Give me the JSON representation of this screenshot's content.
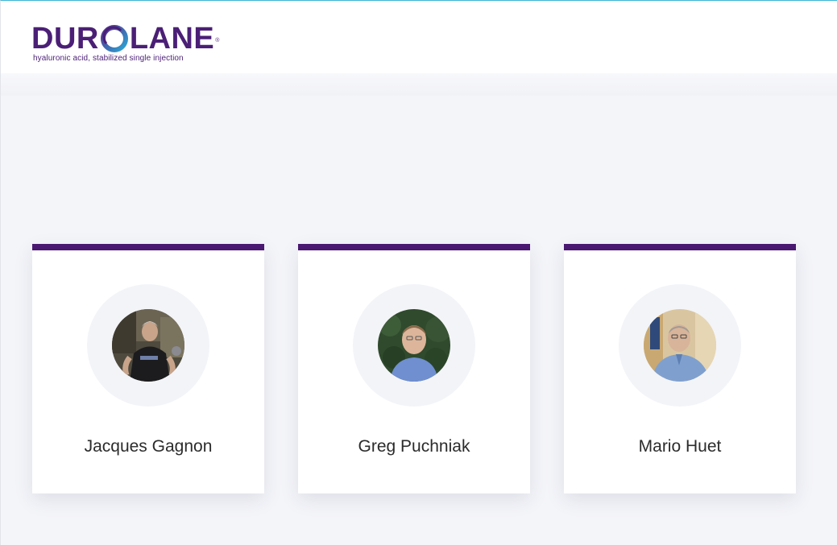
{
  "brand": {
    "name_left": "DUR",
    "name_right": "LANE",
    "registered": "®",
    "tagline": "hyaluronic acid, stabilized single injection",
    "colors": {
      "primary": "#4b1f76",
      "accent": "#3bb6d6"
    }
  },
  "testimonials": [
    {
      "name": "Jacques Gagnon",
      "avatar_icon": "runner-photo"
    },
    {
      "name": "Greg Puchniak",
      "avatar_icon": "man-outdoors-photo"
    },
    {
      "name": "Mario Huet",
      "avatar_icon": "man-smiling-photo"
    }
  ],
  "colors": {
    "card_top_border": "#4a1870",
    "page_background": "#f4f5f9"
  }
}
